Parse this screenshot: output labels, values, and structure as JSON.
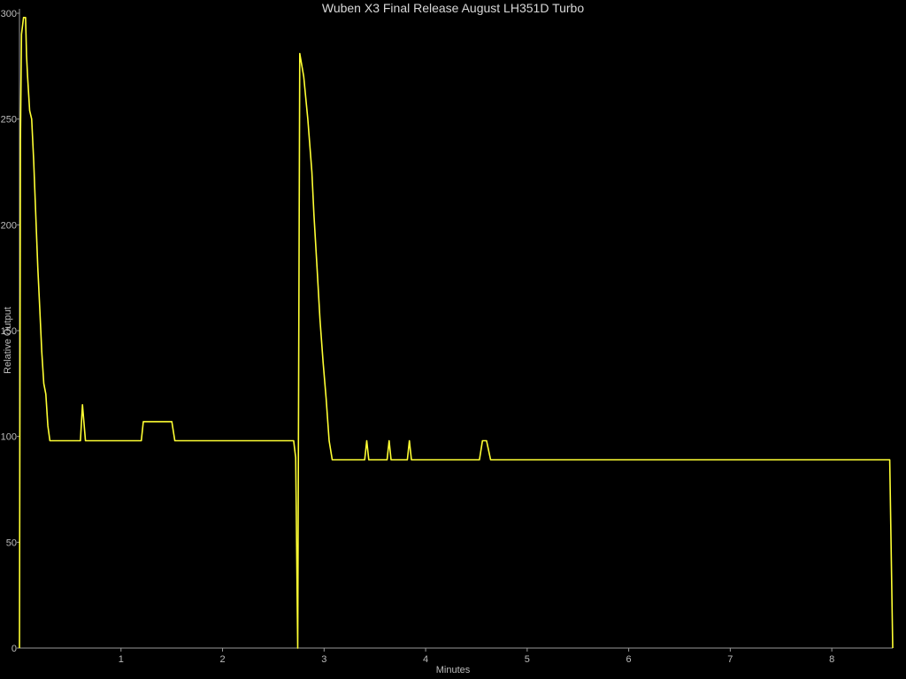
{
  "chart_data": {
    "type": "line",
    "title": "Wuben X3 Final Release August LH351D Turbo",
    "xlabel": "Minutes",
    "ylabel": "Relative Output",
    "xlim": [
      0,
      8.6
    ],
    "ylim": [
      0,
      300
    ],
    "xticks": [
      1,
      2,
      3,
      4,
      5,
      6,
      7,
      8
    ],
    "yticks": [
      0,
      50,
      100,
      150,
      200,
      250,
      300
    ],
    "grid": false,
    "colors": {
      "background": "#000000",
      "line": "#ffff33",
      "axis": "#9a9a9a",
      "text": "#bdbdbd"
    },
    "series": [
      {
        "x": [
          0.0,
          0.01,
          0.02,
          0.04,
          0.06,
          0.07,
          0.08,
          0.1,
          0.12,
          0.14,
          0.16,
          0.18,
          0.2,
          0.22,
          0.24,
          0.26,
          0.28,
          0.3,
          0.33,
          0.35,
          0.38,
          0.6,
          0.62,
          0.65,
          0.68,
          1.1,
          1.2,
          1.22,
          1.25,
          1.45,
          1.5,
          1.53,
          2.6,
          2.65,
          2.7,
          2.72,
          2.74,
          2.76,
          2.8,
          2.84,
          2.88,
          2.9,
          2.93,
          2.96,
          2.99,
          3.02,
          3.05,
          3.08,
          3.1,
          3.4,
          3.42,
          3.44,
          3.62,
          3.64,
          3.66,
          3.82,
          3.84,
          3.86,
          4.5,
          4.53,
          4.56,
          4.6,
          4.64,
          8.55,
          8.57,
          8.6
        ],
        "y": [
          0,
          240,
          290,
          298,
          298,
          280,
          270,
          254,
          250,
          230,
          205,
          180,
          160,
          140,
          125,
          120,
          105,
          98,
          98,
          98,
          98,
          98,
          115,
          98,
          98,
          98,
          98,
          107,
          107,
          107,
          107,
          98,
          98,
          98,
          98,
          90,
          0,
          281,
          270,
          250,
          225,
          205,
          180,
          155,
          135,
          118,
          98,
          89,
          89,
          89,
          98,
          89,
          89,
          98,
          89,
          89,
          98,
          89,
          89,
          89,
          98,
          98,
          89,
          89,
          89,
          0
        ]
      }
    ]
  }
}
